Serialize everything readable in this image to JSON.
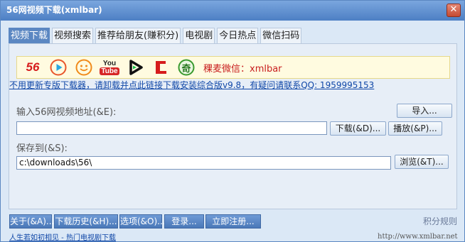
{
  "window": {
    "title": "56网视频下载(xmlbar)",
    "close_glyph": "✕"
  },
  "tabs": [
    {
      "label": "视频下载"
    },
    {
      "label": "视频搜索"
    },
    {
      "label": "推荐给朋友(赚积分)"
    },
    {
      "label": "电视剧"
    },
    {
      "label": "今日热点"
    },
    {
      "label": "微信扫码"
    }
  ],
  "logos": {
    "l56": "56",
    "youtube_top": "You",
    "youtube_bottom": "Tube",
    "qi": "奇",
    "wechat_text": "稞麦微信：xmlbar"
  },
  "notice": "不用更新专版下载器，请卸载并点此链接下载安装综合版v9.8，有疑问请联系QQ: 1959995153",
  "url_section": {
    "label": "输入56网视频地址(&E):",
    "import_button": "导入...",
    "value": "",
    "download_button": "下载(&D)...",
    "play_button": "播放(&P)..."
  },
  "save_section": {
    "label": "保存到(&S):",
    "value": "c:\\downloads\\56\\",
    "browse_button": "浏览(&T)..."
  },
  "bottom_buttons": [
    {
      "label": "关于(&A)..."
    },
    {
      "label": "下载历史(&H)..."
    },
    {
      "label": "选项(&O)..."
    },
    {
      "label": "登录..."
    },
    {
      "label": "立即注册..."
    }
  ],
  "score_rules": "积分规则",
  "footer": {
    "link": "人生若如初相见 - 热门电视剧下载",
    "url": "http://www.xmlbar.net"
  },
  "colors": {
    "titlebar": "#4d7fc4",
    "active_tab": "#5b87c2",
    "wechat_text": "#c81e1e",
    "link": "#1148a8"
  }
}
